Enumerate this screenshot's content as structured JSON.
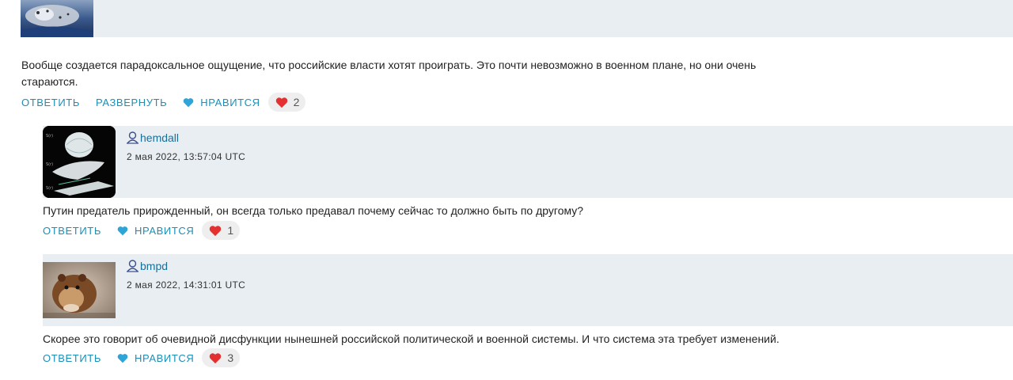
{
  "comments": [
    {
      "text": "Вообще создается парадоксальное ощущение, что российские власти хотят проиграть. Это почти невозможно в военном плане, но они очень стараются.",
      "actions": {
        "reply": "ОТВЕТИТЬ",
        "expand": "РАЗВЕРНУТЬ",
        "like": "НРАВИТСЯ"
      },
      "likes": "2"
    },
    {
      "username": "hemdall",
      "date": "2 мая 2022, 13:57:04 UTC",
      "text": "Путин предатель прирожденный, он всегда только предавал почему сейчас то должно быть по другому?",
      "actions": {
        "reply": "ОТВЕТИТЬ",
        "like": "НРАВИТСЯ"
      },
      "likes": "1"
    },
    {
      "username": "bmpd",
      "date": "2 мая 2022, 14:31:01 UTC",
      "text": "Скорее это говорит об очевидной дисфункции нынешней российской политической и военной системы. И что система эта требует изменений.",
      "actions": {
        "reply": "ОТВЕТИТЬ",
        "like": "НРАВИТСЯ"
      },
      "likes": "3"
    }
  ],
  "colors": {
    "link": "#1a8fb8",
    "band": "#e9eef2",
    "heart": "#e33030",
    "heart_blue": "#2ea4d8"
  }
}
